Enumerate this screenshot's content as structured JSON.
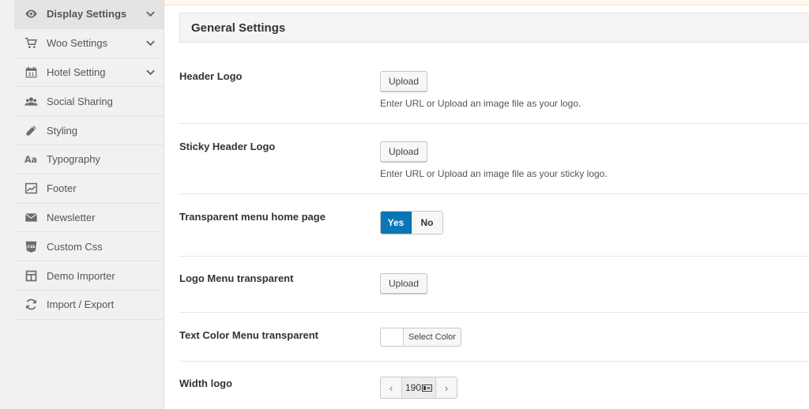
{
  "sidebar": {
    "items": [
      {
        "label": "Display Settings",
        "icon": "eye-icon",
        "active": true,
        "expandable": true
      },
      {
        "label": "Woo Settings",
        "icon": "cart-icon",
        "expandable": true
      },
      {
        "label": "Hotel Setting",
        "icon": "calendar-icon",
        "expandable": true
      },
      {
        "label": "Social Sharing",
        "icon": "users-icon"
      },
      {
        "label": "Styling",
        "icon": "pencil-icon"
      },
      {
        "label": "Typography",
        "icon": "typography-icon"
      },
      {
        "label": "Footer",
        "icon": "chart-icon"
      },
      {
        "label": "Newsletter",
        "icon": "envelope-icon"
      },
      {
        "label": "Custom Css",
        "icon": "css-icon"
      },
      {
        "label": "Demo Importer",
        "icon": "layout-icon"
      },
      {
        "label": "Import / Export",
        "icon": "refresh-icon"
      }
    ]
  },
  "main": {
    "section_title": "General Settings",
    "header_logo": {
      "label": "Header Logo",
      "button": "Upload",
      "description": "Enter URL or Upload an image file as your logo."
    },
    "sticky_header_logo": {
      "label": "Sticky Header Logo",
      "button": "Upload",
      "description": "Enter URL or Upload an image file as your sticky logo."
    },
    "transparent_menu": {
      "label": "Transparent menu home page",
      "yes": "Yes",
      "no": "No",
      "selected": "Yes"
    },
    "logo_menu_transparent": {
      "label": "Logo Menu transparent",
      "button": "Upload"
    },
    "text_color_menu": {
      "label": "Text Color Menu transparent",
      "button": "Select Color",
      "swatch_color": "#ffffff"
    },
    "width_logo": {
      "label": "Width logo",
      "value": "190",
      "prev": "‹",
      "next": "›"
    }
  },
  "colors": {
    "accent": "#0a76b7"
  }
}
